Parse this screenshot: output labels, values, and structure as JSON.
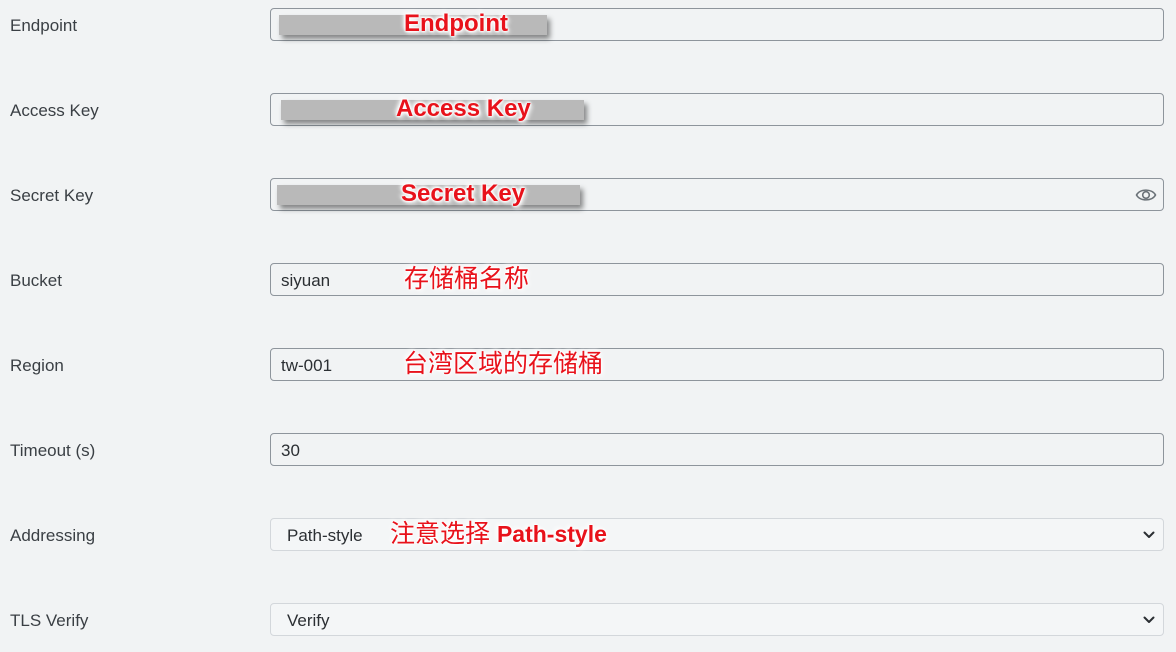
{
  "fields": [
    {
      "label": "Endpoint",
      "value": "",
      "annotation": "Endpoint"
    },
    {
      "label": "Access Key",
      "value": "",
      "annotation": "Access Key"
    },
    {
      "label": "Secret Key",
      "value": "",
      "annotation": "Secret Key",
      "icon": "eye-icon"
    },
    {
      "label": "Bucket",
      "value": "siyuan",
      "annotation": "存储桶名称"
    },
    {
      "label": "Region",
      "value": "tw-001",
      "annotation": "台湾区域的存储桶"
    },
    {
      "label": "Timeout (s)",
      "value": "30"
    },
    {
      "label": "Addressing",
      "selected": "Path-style",
      "annotation_cn": "注意选择",
      "annotation_en": "Path-style",
      "icon": "chevron-down-icon"
    },
    {
      "label": "TLS Verify",
      "selected": "Verify",
      "icon": "chevron-down-icon"
    }
  ],
  "colors": {
    "background": "#f1f3f4",
    "annotation": "#e8121b",
    "redaction": "#b9b9b9"
  }
}
